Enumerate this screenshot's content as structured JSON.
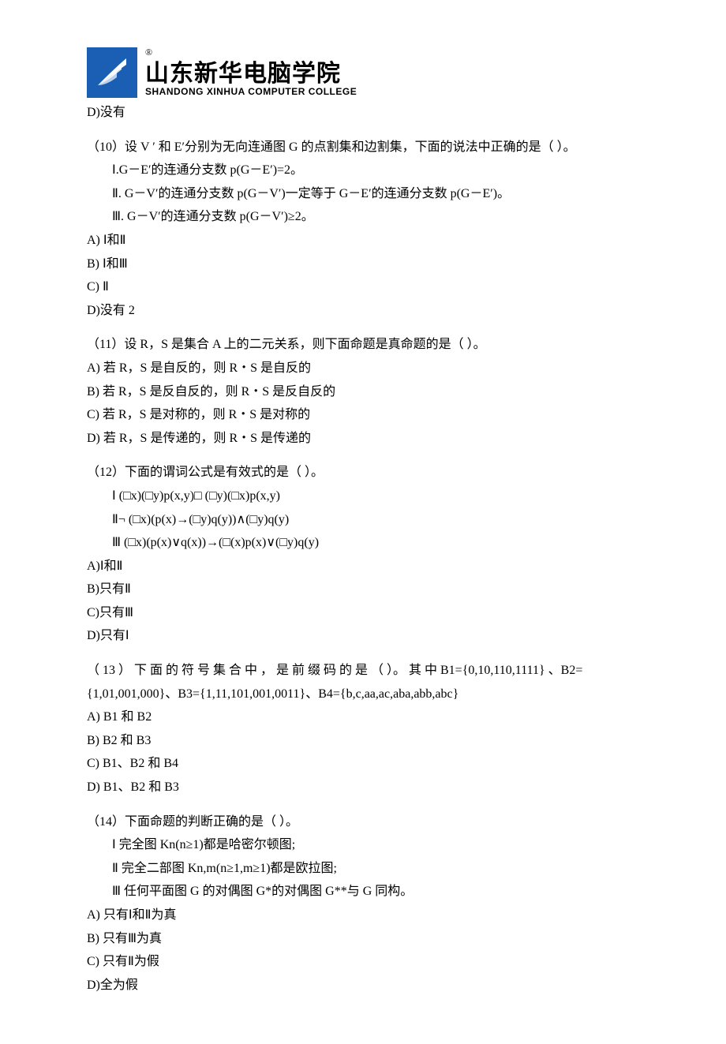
{
  "header": {
    "logo_cn": "山东新华电脑学院",
    "logo_en": "SHANDONG XINHUA COMPUTER COLLEGE"
  },
  "frag_top": "D)没有",
  "q10": {
    "stem": "（10）设 V ′ 和 E′分别为无向连通图 G 的点割集和边割集，下面的说法中正确的是（  ）。",
    "s1": "Ⅰ.G－E′的连通分支数 p(G－E′)=2。",
    "s2": "Ⅱ. G－V′的连通分支数 p(G－V′)一定等于 G－E′的连通分支数 p(G－E′)。",
    "s3": "Ⅲ. G－V′的连通分支数 p(G－V′)≥2。",
    "a": "A) Ⅰ和Ⅱ",
    "b": "B) Ⅰ和Ⅲ",
    "c": "C) Ⅱ",
    "d": "D)没有 2"
  },
  "q11": {
    "stem": "（11）设 R，S 是集合 A 上的二元关系，则下面命题是真命题的是（  ）。",
    "a": "A) 若 R，S 是自反的，则 R・S 是自反的",
    "b": "B) 若 R，S 是反自反的，则 R・S 是反自反的",
    "c": "C) 若 R，S 是对称的，则 R・S 是对称的",
    "d": "D) 若 R，S 是传递的，则 R・S 是传递的"
  },
  "q12": {
    "stem": "（12）下面的谓词公式是有效式的是（  ）。",
    "s1": "Ⅰ (□x)(□y)p(x,y)□ (□y)(□x)p(x,y)",
    "s2": "Ⅱ¬ (□x)(p(x)→(□y)q(y))∧(□y)q(y)",
    "s3": "Ⅲ (□x)(p(x)∨q(x))→(□(x)p(x)∨(□y)q(y)",
    "a": "A)Ⅰ和Ⅱ",
    "b": "B)只有Ⅱ",
    "c": "C)只有Ⅲ",
    "d": "D)只有Ⅰ"
  },
  "q13": {
    "stem": "（ 13 ） 下 面 的 符 号 集 合 中 ， 是 前 缀 码 的 是 （     ）。 其 中 B1={0,10,110,1111} 、B2={1,01,001,000}、B3={1,11,101,001,0011}、B4={b,c,aa,ac,aba,abb,abc}",
    "a": "A) B1 和 B2",
    "b": "B) B2 和 B3",
    "c": "C) B1、B2 和 B4",
    "d": "D) B1、B2 和 B3"
  },
  "q14": {
    "stem": "（14）下面命题的判断正确的是（  ）。",
    "s1": "Ⅰ 完全图 Kn(n≥1)都是哈密尔顿图;",
    "s2": "Ⅱ 完全二部图 Kn,m(n≥1,m≥1)都是欧拉图;",
    "s3": "Ⅲ 任何平面图 G 的对偶图 G*的对偶图 G**与 G 同构。",
    "a": "A) 只有Ⅰ和Ⅱ为真",
    "b": "B) 只有Ⅲ为真",
    "c": "C) 只有Ⅱ为假",
    "d": "D)全为假"
  }
}
